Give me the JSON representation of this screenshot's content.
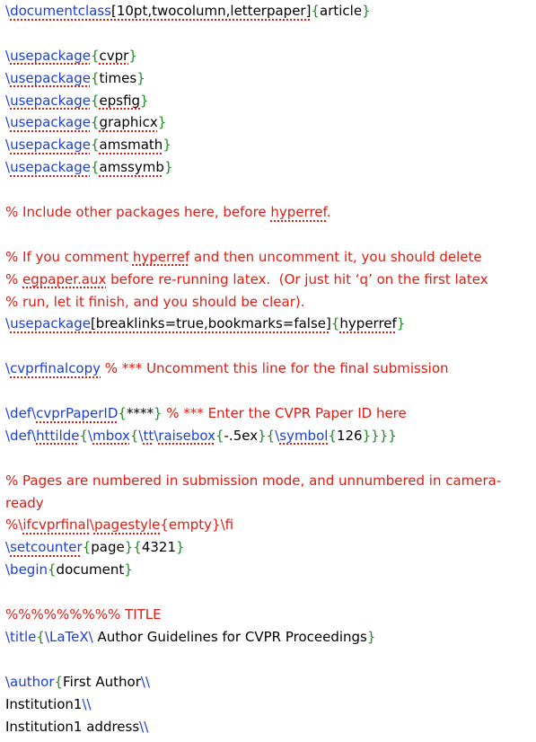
{
  "editor": {
    "lines": [
      [
        {
          "t": "\\",
          "c": "cmd"
        },
        {
          "t": "documentclass",
          "c": "cmd",
          "sq": true
        },
        {
          "t": "[10pt,twocolumn,letterpaper]",
          "c": "plain",
          "sq": true
        },
        {
          "t": "{",
          "c": "brace"
        },
        {
          "t": "article",
          "c": "plain"
        },
        {
          "t": "}",
          "c": "brace"
        }
      ],
      [],
      [
        {
          "t": "\\",
          "c": "cmd"
        },
        {
          "t": "usepackage",
          "c": "cmd",
          "sq": true
        },
        {
          "t": "{",
          "c": "brace"
        },
        {
          "t": "cvpr",
          "c": "plain",
          "sq": true
        },
        {
          "t": "}",
          "c": "brace"
        }
      ],
      [
        {
          "t": "\\",
          "c": "cmd"
        },
        {
          "t": "usepackage",
          "c": "cmd",
          "sq": true
        },
        {
          "t": "{",
          "c": "brace"
        },
        {
          "t": "times",
          "c": "plain"
        },
        {
          "t": "}",
          "c": "brace"
        }
      ],
      [
        {
          "t": "\\",
          "c": "cmd"
        },
        {
          "t": "usepackage",
          "c": "cmd",
          "sq": true
        },
        {
          "t": "{",
          "c": "brace"
        },
        {
          "t": "epsfig",
          "c": "plain",
          "sq": true
        },
        {
          "t": "}",
          "c": "brace"
        }
      ],
      [
        {
          "t": "\\",
          "c": "cmd"
        },
        {
          "t": "usepackage",
          "c": "cmd",
          "sq": true
        },
        {
          "t": "{",
          "c": "brace"
        },
        {
          "t": "graphicx",
          "c": "plain",
          "sq": true
        },
        {
          "t": "}",
          "c": "brace"
        }
      ],
      [
        {
          "t": "\\",
          "c": "cmd"
        },
        {
          "t": "usepackage",
          "c": "cmd",
          "sq": true
        },
        {
          "t": "{",
          "c": "brace"
        },
        {
          "t": "amsmath",
          "c": "plain",
          "sq": true
        },
        {
          "t": "}",
          "c": "brace"
        }
      ],
      [
        {
          "t": "\\",
          "c": "cmd"
        },
        {
          "t": "usepackage",
          "c": "cmd",
          "sq": true
        },
        {
          "t": "{",
          "c": "brace"
        },
        {
          "t": "amssymb",
          "c": "plain",
          "sq": true
        },
        {
          "t": "}",
          "c": "brace"
        }
      ],
      [],
      [
        {
          "t": "% Include other packages here, before ",
          "c": "comment"
        },
        {
          "t": "hyperref",
          "c": "comment",
          "sq": true
        },
        {
          "t": ".",
          "c": "comment"
        }
      ],
      [],
      [
        {
          "t": "% If you comment ",
          "c": "comment"
        },
        {
          "t": "hyperref",
          "c": "comment",
          "sq": true
        },
        {
          "t": " and then uncomment it, you should delete",
          "c": "comment"
        }
      ],
      [
        {
          "t": "% ",
          "c": "comment"
        },
        {
          "t": "egpaper.aux",
          "c": "comment",
          "sq": true
        },
        {
          "t": " before re-running latex.  (Or just hit ‘q’ on the first latex",
          "c": "comment"
        }
      ],
      [
        {
          "t": "% run, let it finish, and you should be clear).",
          "c": "comment"
        }
      ],
      [
        {
          "t": "\\",
          "c": "cmd"
        },
        {
          "t": "usepackage",
          "c": "cmd",
          "sq": true
        },
        {
          "t": "[breaklinks=true,bookmarks=false]",
          "c": "plain",
          "sq": true
        },
        {
          "t": "{",
          "c": "brace"
        },
        {
          "t": "hyperref",
          "c": "plain",
          "sq": true
        },
        {
          "t": "}",
          "c": "brace"
        }
      ],
      [],
      [
        {
          "t": "\\",
          "c": "cmd"
        },
        {
          "t": "cvprfinalcopy",
          "c": "cmd",
          "sq": true
        },
        {
          "t": " % *** Uncomment this line for the final submission",
          "c": "comment"
        }
      ],
      [],
      [
        {
          "t": "\\def\\",
          "c": "cmd"
        },
        {
          "t": "cvprPaperID",
          "c": "cmd",
          "sq": true
        },
        {
          "t": "{",
          "c": "brace"
        },
        {
          "t": "****",
          "c": "plain"
        },
        {
          "t": "}",
          "c": "brace"
        },
        {
          "t": " % *** Enter the CVPR Paper ID here",
          "c": "comment"
        }
      ],
      [
        {
          "t": "\\def\\",
          "c": "cmd"
        },
        {
          "t": "httilde",
          "c": "cmd",
          "sq": true
        },
        {
          "t": "{",
          "c": "brace"
        },
        {
          "t": "\\",
          "c": "cmd"
        },
        {
          "t": "mbox",
          "c": "cmd",
          "sq": true
        },
        {
          "t": "{",
          "c": "brace"
        },
        {
          "t": "\\",
          "c": "cmd"
        },
        {
          "t": "tt",
          "c": "cmd",
          "sq": true
        },
        {
          "t": "\\",
          "c": "cmd"
        },
        {
          "t": "raisebox",
          "c": "cmd",
          "sq": true
        },
        {
          "t": "{",
          "c": "brace"
        },
        {
          "t": "-.5ex",
          "c": "plain"
        },
        {
          "t": "}{",
          "c": "brace"
        },
        {
          "t": "\\",
          "c": "cmd"
        },
        {
          "t": "symbol",
          "c": "cmd",
          "sq": true
        },
        {
          "t": "{",
          "c": "brace"
        },
        {
          "t": "126",
          "c": "plain"
        },
        {
          "t": "}}}}",
          "c": "brace"
        }
      ],
      [],
      [
        {
          "t": "% Pages are numbered in submission mode, and unnumbered in camera-",
          "c": "comment"
        }
      ],
      [
        {
          "t": "ready",
          "c": "comment"
        }
      ],
      [
        {
          "t": "%\\",
          "c": "comment"
        },
        {
          "t": "ifcvprfinal",
          "c": "comment",
          "sq": true
        },
        {
          "t": "\\",
          "c": "comment"
        },
        {
          "t": "pagestyle",
          "c": "comment",
          "sq": true
        },
        {
          "t": "{empty}\\fi",
          "c": "comment"
        }
      ],
      [
        {
          "t": "\\",
          "c": "cmd"
        },
        {
          "t": "setcounter",
          "c": "cmd",
          "sq": true
        },
        {
          "t": "{",
          "c": "brace"
        },
        {
          "t": "page",
          "c": "plain"
        },
        {
          "t": "}{",
          "c": "brace"
        },
        {
          "t": "4321",
          "c": "plain"
        },
        {
          "t": "}",
          "c": "brace"
        }
      ],
      [
        {
          "t": "\\begin",
          "c": "cmd"
        },
        {
          "t": "{",
          "c": "brace"
        },
        {
          "t": "document",
          "c": "plain"
        },
        {
          "t": "}",
          "c": "brace"
        }
      ],
      [],
      [
        {
          "t": "%%%%%%%%% TITLE",
          "c": "comment"
        }
      ],
      [
        {
          "t": "\\title",
          "c": "cmd"
        },
        {
          "t": "{",
          "c": "brace"
        },
        {
          "t": "\\LaTeX\\",
          "c": "cmd"
        },
        {
          "t": " Author Guidelines for CVPR Proceedings",
          "c": "plain"
        },
        {
          "t": "}",
          "c": "brace"
        }
      ],
      [],
      [
        {
          "t": "\\author",
          "c": "cmd"
        },
        {
          "t": "{",
          "c": "brace"
        },
        {
          "t": "First Author",
          "c": "plain"
        },
        {
          "t": "\\\\",
          "c": "cmd"
        }
      ],
      [
        {
          "t": "Institution1",
          "c": "plain"
        },
        {
          "t": "\\\\",
          "c": "cmd"
        }
      ],
      [
        {
          "t": "Institution1 address",
          "c": "plain"
        },
        {
          "t": "\\\\",
          "c": "cmd"
        }
      ]
    ]
  },
  "colors": {
    "command": "#1b3fd6",
    "brace": "#1f8a24",
    "comment": "#e01b12",
    "plain": "#000000",
    "spellcheck_underline": "#e01b12"
  }
}
